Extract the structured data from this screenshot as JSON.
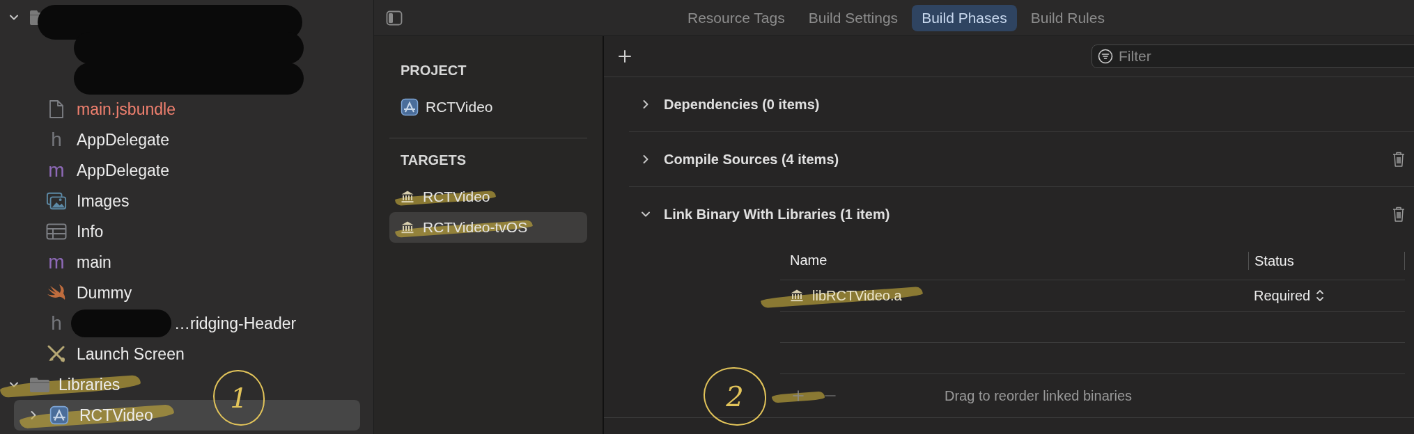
{
  "navigator": {
    "tree": [
      {
        "kind": "folder",
        "redacted": true,
        "expanded": true,
        "children": [
          {
            "kind": "hidden",
            "redacted": true
          },
          {
            "kind": "hidden",
            "redacted": true
          },
          {
            "kind": "file",
            "label": "main.jsbundle",
            "missing": true
          },
          {
            "kind": "header",
            "icon": "h",
            "label": "AppDelegate"
          },
          {
            "kind": "objc",
            "icon": "m",
            "label": "AppDelegate"
          },
          {
            "kind": "assets",
            "label": "Images"
          },
          {
            "kind": "plist",
            "label": "Info"
          },
          {
            "kind": "objc",
            "icon": "m",
            "label": "main"
          },
          {
            "kind": "swift",
            "label": "Dummy"
          },
          {
            "kind": "header",
            "icon": "h",
            "label": "…ridging-Header",
            "redacted": true
          },
          {
            "kind": "storyboard",
            "label": "Launch Screen"
          }
        ]
      },
      {
        "kind": "folder",
        "label": "Libraries",
        "expanded": true,
        "highlighted": true,
        "children": [
          {
            "kind": "project",
            "label": "RCTVideo",
            "expanded": false,
            "highlighted": true,
            "selected": true
          }
        ]
      }
    ]
  },
  "editor_tabs": [
    {
      "label": "Resource Tags",
      "selected": false
    },
    {
      "label": "Build Settings",
      "selected": false
    },
    {
      "label": "Build Phases",
      "selected": true
    },
    {
      "label": "Build Rules",
      "selected": false
    }
  ],
  "targets_panel": {
    "project_heading": "PROJECT",
    "project": {
      "label": "RCTVideo"
    },
    "targets_heading": "TARGETS",
    "targets": [
      {
        "label": "RCTVideo",
        "selected": false,
        "highlighted": true
      },
      {
        "label": "RCTVideo-tvOS",
        "selected": true,
        "highlighted": true
      }
    ]
  },
  "build_phases": {
    "filter": {
      "placeholder": "Filter"
    },
    "phases": [
      {
        "title": "Dependencies (0 items)",
        "expanded": false,
        "deletable": false
      },
      {
        "title": "Compile Sources (4 items)",
        "expanded": false,
        "deletable": true
      },
      {
        "title": "Link Binary With Libraries (1 item)",
        "expanded": true,
        "deletable": true,
        "table": {
          "columns": [
            "Name",
            "Status"
          ],
          "rows": [
            {
              "name": "libRCTVideo.a",
              "status": "Required",
              "highlighted": true
            }
          ],
          "footer": "Drag to reorder linked binaries",
          "add_highlighted": true
        }
      }
    ]
  },
  "annotations": [
    {
      "label": "1"
    },
    {
      "label": "2"
    }
  ]
}
